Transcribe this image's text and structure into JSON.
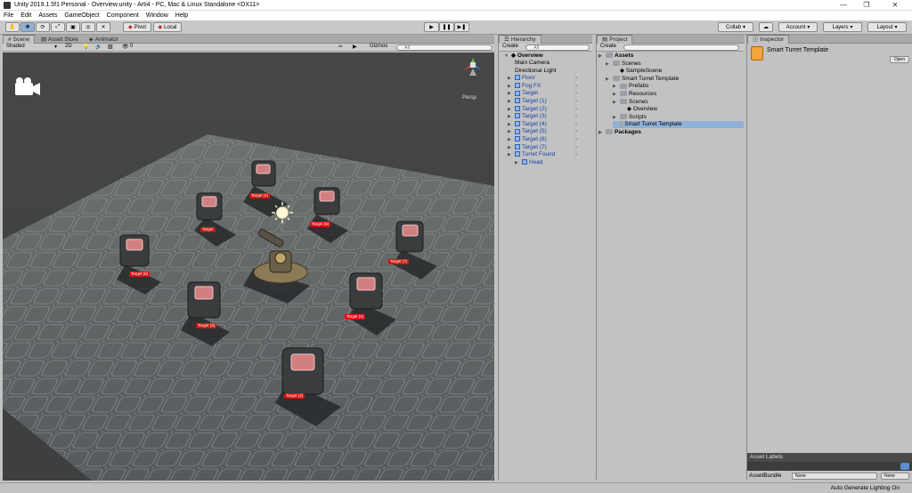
{
  "window": {
    "title": "Unity 2019.1.5f1 Personal - Overview.unity - Arti4 - PC, Mac & Linux Standalone <DX11>"
  },
  "menu": [
    "File",
    "Edit",
    "Assets",
    "GameObject",
    "Component",
    "Window",
    "Help"
  ],
  "toolbar": {
    "pivot": "Pivot",
    "local": "Local",
    "collab": "Collab",
    "account": "Account",
    "layers": "Layers",
    "layout": "Layout"
  },
  "scene_tabs": [
    "Scene",
    "Asset Store",
    "Animator"
  ],
  "scene_toolbar": {
    "shading": "Shaded",
    "mode2d": "2D",
    "fx_count": "0",
    "gizmos": "Gizmos",
    "search": "All"
  },
  "scene_gizmo": {
    "persp": "Persp"
  },
  "targets": [
    {
      "label": "Target (1)"
    },
    {
      "label": "Target"
    },
    {
      "label": "Target (5)"
    },
    {
      "label": "Target (7)"
    },
    {
      "label": "Target (6)"
    },
    {
      "label": "Target (4)"
    },
    {
      "label": "Target (3)"
    },
    {
      "label": "Target (3)"
    }
  ],
  "hierarchy": {
    "tab": "Hierarchy",
    "create": "Create",
    "search": "All",
    "scene": "Overview",
    "items": [
      {
        "label": "Main Camera",
        "type": "plain",
        "depth": 1
      },
      {
        "label": "Directional Light",
        "type": "plain",
        "depth": 1
      },
      {
        "label": "Floor",
        "type": "prefab",
        "depth": 1,
        "chevron": true
      },
      {
        "label": "Fog FX",
        "type": "prefab",
        "depth": 1,
        "chevron": true
      },
      {
        "label": "Target",
        "type": "prefab",
        "depth": 1,
        "chevron": true
      },
      {
        "label": "Target (1)",
        "type": "prefab",
        "depth": 1,
        "chevron": true
      },
      {
        "label": "Target (2)",
        "type": "prefab",
        "depth": 1,
        "chevron": true
      },
      {
        "label": "Target (3)",
        "type": "prefab",
        "depth": 1,
        "chevron": true
      },
      {
        "label": "Target (4)",
        "type": "prefab",
        "depth": 1,
        "chevron": true
      },
      {
        "label": "Target (5)",
        "type": "prefab",
        "depth": 1,
        "chevron": true
      },
      {
        "label": "Target (6)",
        "type": "prefab",
        "depth": 1,
        "chevron": true
      },
      {
        "label": "Target (7)",
        "type": "prefab",
        "depth": 1,
        "chevron": true
      },
      {
        "label": "Turret Found",
        "type": "prefab",
        "depth": 1,
        "chevron": true
      },
      {
        "label": "Head",
        "type": "prefab",
        "depth": 2,
        "chevron": false
      }
    ]
  },
  "project": {
    "tab": "Project",
    "create": "Create",
    "items": [
      {
        "label": "Assets",
        "depth": 0,
        "bold": true
      },
      {
        "label": "Scenes",
        "depth": 1
      },
      {
        "label": "SampleScene",
        "depth": 2,
        "scene": true
      },
      {
        "label": "Smart Turret Template",
        "depth": 1
      },
      {
        "label": "Prefabs",
        "depth": 2
      },
      {
        "label": "Resources",
        "depth": 2
      },
      {
        "label": "Scenes",
        "depth": 2
      },
      {
        "label": "Overview",
        "depth": 3,
        "scene": true
      },
      {
        "label": "Scripts",
        "depth": 2
      },
      {
        "label": "Smart Turret Template",
        "depth": 2,
        "selected": true
      },
      {
        "label": "Packages",
        "depth": 0,
        "bold": true
      }
    ]
  },
  "inspector": {
    "tab": "Inspector",
    "asset_name": "Smart Turret Template",
    "open": "Open",
    "asset_labels": "Asset Labels",
    "assetbundle": "AssetBundle",
    "none1": "None",
    "none2": "None"
  },
  "status": "Auto Generate Lighting On",
  "colors": {
    "selection": "#8fb0d8",
    "label_red": "#dd1111",
    "prefab_blue": "#1a3fa8"
  }
}
